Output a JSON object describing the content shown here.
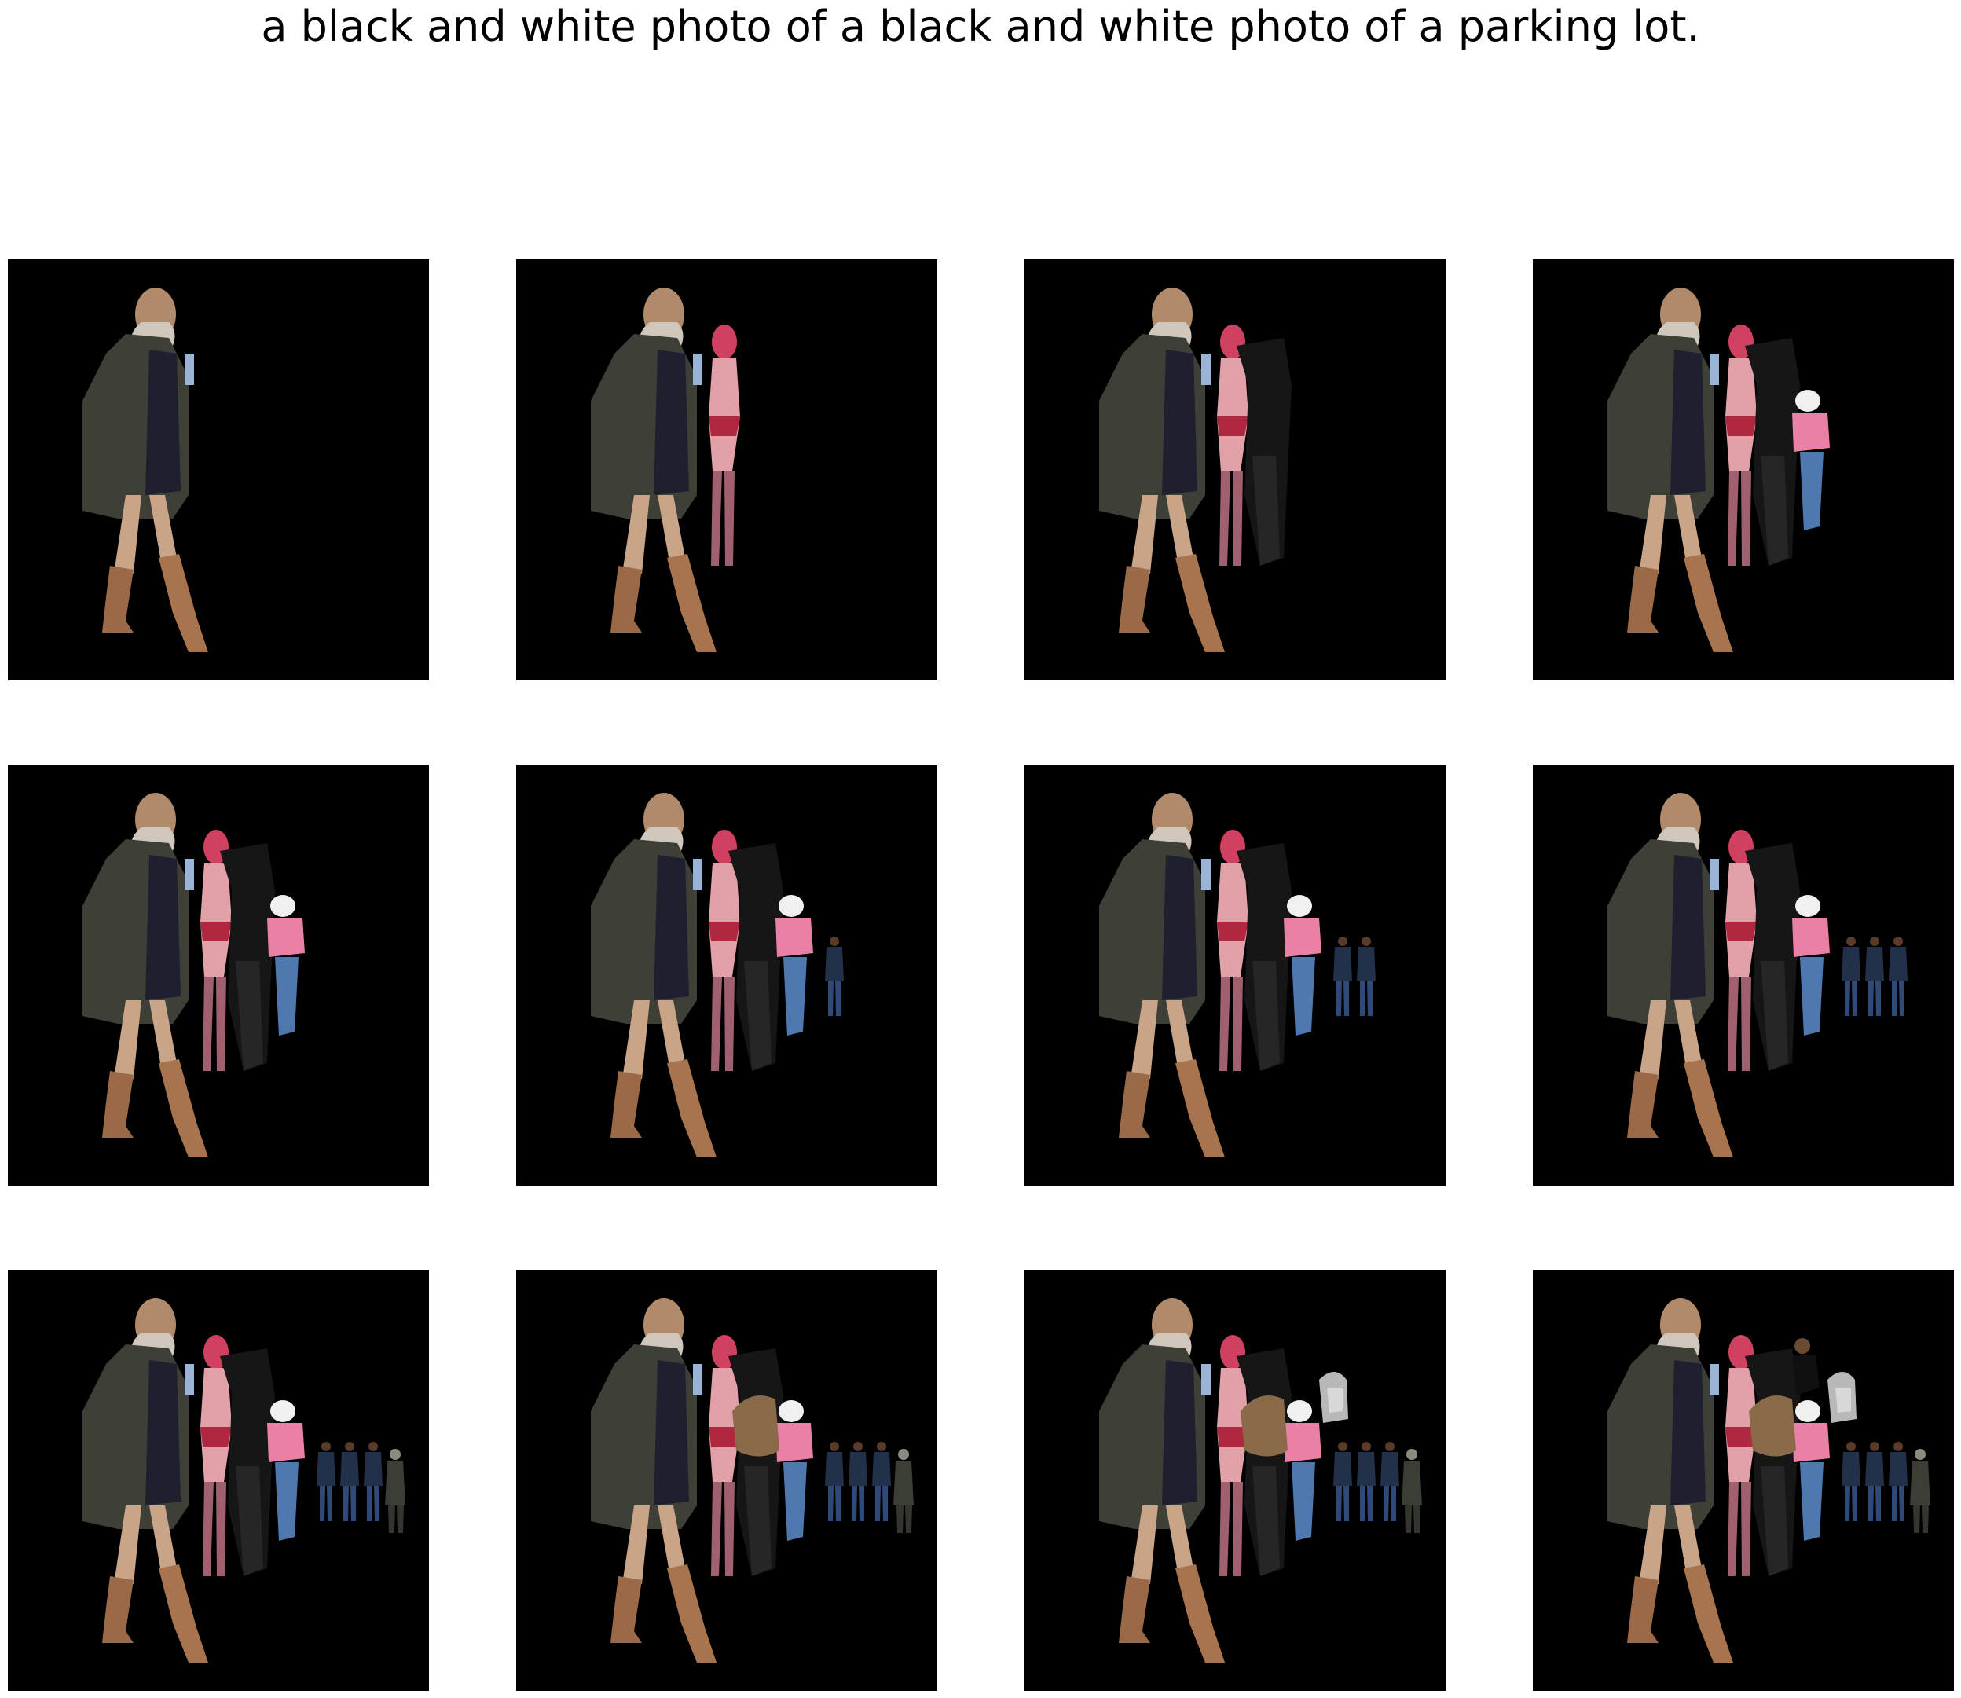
{
  "caption": "a black and white photo of a black and white photo of a parking lot.",
  "colors": {
    "background": "#ffffff",
    "panel": "#000000"
  },
  "grid": {
    "rows": 3,
    "cols": 4
  },
  "panels": [
    {
      "index": 1,
      "figures": [
        "woman-coat"
      ]
    },
    {
      "index": 2,
      "figures": [
        "woman-coat",
        "pink-figure"
      ]
    },
    {
      "index": 3,
      "figures": [
        "woman-coat",
        "pink-figure",
        "dark-figure"
      ]
    },
    {
      "index": 4,
      "figures": [
        "woman-coat",
        "pink-figure",
        "dark-figure",
        "pink-shirt-figure"
      ]
    },
    {
      "index": 5,
      "figures": [
        "woman-coat",
        "pink-figure",
        "dark-figure",
        "pink-shirt-figure"
      ]
    },
    {
      "index": 6,
      "figures": [
        "woman-coat",
        "pink-figure",
        "dark-figure",
        "pink-shirt-figure",
        "small-group-1"
      ]
    },
    {
      "index": 7,
      "figures": [
        "woman-coat",
        "pink-figure",
        "dark-figure",
        "pink-shirt-figure",
        "small-group-2"
      ]
    },
    {
      "index": 8,
      "figures": [
        "woman-coat",
        "pink-figure",
        "dark-figure",
        "pink-shirt-figure",
        "small-group-3"
      ]
    },
    {
      "index": 9,
      "figures": [
        "woman-coat",
        "pink-figure",
        "dark-figure",
        "pink-shirt-figure",
        "small-group-3",
        "soldier"
      ]
    },
    {
      "index": 10,
      "figures": [
        "woman-coat",
        "pink-figure",
        "dark-figure",
        "pink-shirt-figure",
        "small-group-3",
        "soldier",
        "hair-blob"
      ]
    },
    {
      "index": 11,
      "figures": [
        "woman-coat",
        "pink-figure",
        "dark-figure",
        "pink-shirt-figure",
        "small-group-3",
        "soldier",
        "hair-blob",
        "gray-head"
      ]
    },
    {
      "index": 12,
      "figures": [
        "woman-coat",
        "pink-figure",
        "dark-figure",
        "pink-shirt-figure",
        "small-group-3",
        "soldier",
        "hair-blob",
        "gray-head",
        "dark-man"
      ]
    }
  ]
}
